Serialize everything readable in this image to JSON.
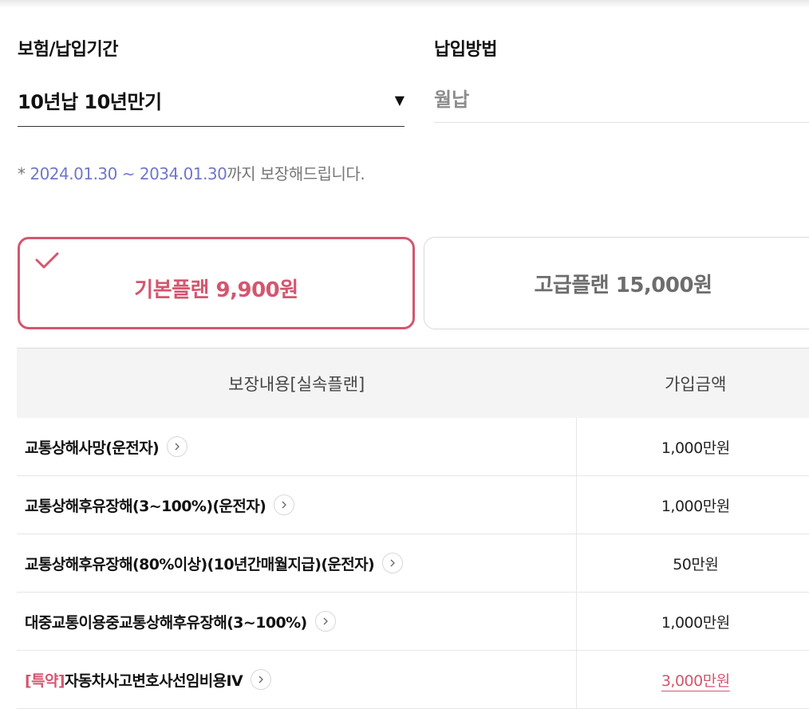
{
  "period_section": {
    "label": "보험/납입기간",
    "selected_value": "10년납 10년만기",
    "dropdown_icon": "triangle-down-icon"
  },
  "payment_section": {
    "label": "납입방법",
    "value": "월납"
  },
  "coverage_note": {
    "prefix": "* ",
    "start_date": "2024.01.30",
    "separator": " ~ ",
    "end_date": "2034.01.30",
    "suffix": "까지 보장해드립니다."
  },
  "plans": {
    "basic_label": "기본플랜 9,900원",
    "premium_label": "고급플랜 15,000원",
    "selected": "basic",
    "accent_color": "#d4566f"
  },
  "table": {
    "header_coverage": "보장내용[실속플랜]",
    "header_amount": "가입금액",
    "rows": [
      {
        "badge": "",
        "name": "교통상해사망(운전자)",
        "amount": "1,000만원"
      },
      {
        "badge": "",
        "name": "교통상해후유장해(3~100%)(운전자)",
        "amount": "1,000만원"
      },
      {
        "badge": "",
        "name": "교통상해후유장해(80%이상)(10년간매월지급)(운전자)",
        "amount": "50만원"
      },
      {
        "badge": "",
        "name": "대중교통이용중교통상해후유장해(3~100%)",
        "amount": "1,000만원"
      },
      {
        "badge": "[특약]",
        "name": "자동차사고변호사선임비용IV",
        "amount": "3,000만원"
      }
    ]
  }
}
